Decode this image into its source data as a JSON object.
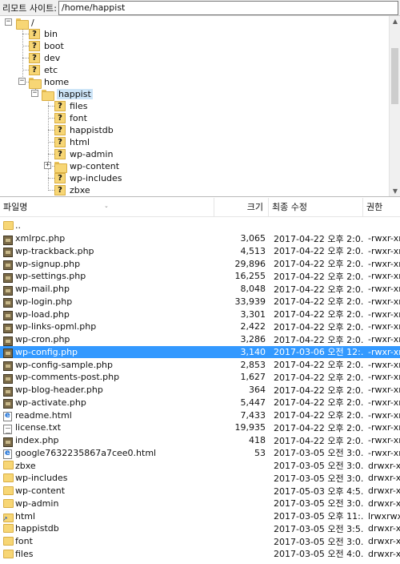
{
  "address_bar": {
    "label": "리모트 사이트:",
    "path": "/home/happist"
  },
  "tree": {
    "root": "/",
    "root_children": [
      "bin",
      "boot",
      "dev",
      "etc"
    ],
    "home": "home",
    "home_child": "happist",
    "happist_children": [
      "files",
      "font",
      "happistdb",
      "html",
      "wp-admin",
      "wp-content",
      "wp-includes",
      "zbxe"
    ]
  },
  "list": {
    "columns": {
      "name": "파일명",
      "size": "크기",
      "modified": "최종 수정",
      "perm": "권한"
    },
    "rows": [
      {
        "icon": "folder-up",
        "name": "..",
        "size": "",
        "date": "",
        "perm": ""
      },
      {
        "icon": "php",
        "name": "xmlrpc.php",
        "size": "3,065",
        "date": "2017-04-22 오후 2:0...",
        "perm": "-rwxr-xr-"
      },
      {
        "icon": "php",
        "name": "wp-trackback.php",
        "size": "4,513",
        "date": "2017-04-22 오후 2:0...",
        "perm": "-rwxr-xr-"
      },
      {
        "icon": "php",
        "name": "wp-signup.php",
        "size": "29,896",
        "date": "2017-04-22 오후 2:0...",
        "perm": "-rwxr-xr-"
      },
      {
        "icon": "php",
        "name": "wp-settings.php",
        "size": "16,255",
        "date": "2017-04-22 오후 2:0...",
        "perm": "-rwxr-xr-"
      },
      {
        "icon": "php",
        "name": "wp-mail.php",
        "size": "8,048",
        "date": "2017-04-22 오후 2:0...",
        "perm": "-rwxr-xr-"
      },
      {
        "icon": "php",
        "name": "wp-login.php",
        "size": "33,939",
        "date": "2017-04-22 오후 2:0...",
        "perm": "-rwxr-xr-"
      },
      {
        "icon": "php",
        "name": "wp-load.php",
        "size": "3,301",
        "date": "2017-04-22 오후 2:0...",
        "perm": "-rwxr-xr-"
      },
      {
        "icon": "php",
        "name": "wp-links-opml.php",
        "size": "2,422",
        "date": "2017-04-22 오후 2:0...",
        "perm": "-rwxr-xr-"
      },
      {
        "icon": "php",
        "name": "wp-cron.php",
        "size": "3,286",
        "date": "2017-04-22 오후 2:0...",
        "perm": "-rwxr-xr-"
      },
      {
        "icon": "php",
        "name": "wp-config.php",
        "size": "3,140",
        "date": "2017-03-06 오전 12:...",
        "perm": "-rwxr-xr-",
        "selected": true
      },
      {
        "icon": "php",
        "name": "wp-config-sample.php",
        "size": "2,853",
        "date": "2017-04-22 오후 2:0...",
        "perm": "-rwxr-xr-"
      },
      {
        "icon": "php",
        "name": "wp-comments-post.php",
        "size": "1,627",
        "date": "2017-04-22 오후 2:0...",
        "perm": "-rwxr-xr-"
      },
      {
        "icon": "php",
        "name": "wp-blog-header.php",
        "size": "364",
        "date": "2017-04-22 오후 2:0...",
        "perm": "-rwxr-xr-"
      },
      {
        "icon": "php",
        "name": "wp-activate.php",
        "size": "5,447",
        "date": "2017-04-22 오후 2:0...",
        "perm": "-rwxr-xr-"
      },
      {
        "icon": "html",
        "name": "readme.html",
        "size": "7,433",
        "date": "2017-04-22 오후 2:0...",
        "perm": "-rwxr-xr-"
      },
      {
        "icon": "txt",
        "name": "license.txt",
        "size": "19,935",
        "date": "2017-04-22 오후 2:0...",
        "perm": "-rwxr-xr-"
      },
      {
        "icon": "php",
        "name": "index.php",
        "size": "418",
        "date": "2017-04-22 오후 2:0...",
        "perm": "-rwxr-xr-"
      },
      {
        "icon": "html",
        "name": "google7632235867a7cee0.html",
        "size": "53",
        "date": "2017-03-05 오전 3:0...",
        "perm": "-rwxr-xr-"
      },
      {
        "icon": "folder",
        "name": "zbxe",
        "size": "",
        "date": "2017-03-05 오전 3:0...",
        "perm": "drwxr-xr"
      },
      {
        "icon": "folder",
        "name": "wp-includes",
        "size": "",
        "date": "2017-03-05 오전 3:0...",
        "perm": "drwxr-xr"
      },
      {
        "icon": "folder",
        "name": "wp-content",
        "size": "",
        "date": "2017-05-03 오후 4:5...",
        "perm": "drwxr-xr"
      },
      {
        "icon": "folder",
        "name": "wp-admin",
        "size": "",
        "date": "2017-03-05 오전 3:0...",
        "perm": "drwxr-xr"
      },
      {
        "icon": "link",
        "name": "html",
        "size": "",
        "date": "2017-03-05 오후 11:...",
        "perm": "lrwxrwxr"
      },
      {
        "icon": "folder",
        "name": "happistdb",
        "size": "",
        "date": "2017-03-05 오전 3:5...",
        "perm": "drwxr-xr"
      },
      {
        "icon": "folder",
        "name": "font",
        "size": "",
        "date": "2017-03-05 오전 3:0...",
        "perm": "drwxr-xr"
      },
      {
        "icon": "folder",
        "name": "files",
        "size": "",
        "date": "2017-03-05 오전 4:0...",
        "perm": "drwxr-xr"
      }
    ]
  }
}
